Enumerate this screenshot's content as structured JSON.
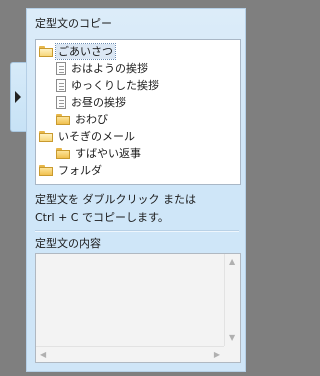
{
  "panel": {
    "copy_section_title": "定型文のコピー",
    "content_section_title": "定型文の内容",
    "help_line1": "定型文を ダブルクリック または",
    "help_line2": "Ctrl + C でコピーします。",
    "content_text": ""
  },
  "tree": [
    {
      "label": "ごあいさつ",
      "type": "folder-open",
      "selected": true
    },
    {
      "label": "おはようの挨拶",
      "type": "document"
    },
    {
      "label": "ゆっくりした挨拶",
      "type": "document"
    },
    {
      "label": "お昼の挨拶",
      "type": "document"
    },
    {
      "label": "おわび",
      "type": "folder"
    },
    {
      "label": "いそぎのメール",
      "type": "folder-open"
    },
    {
      "label": "すばやい返事",
      "type": "folder"
    },
    {
      "label": "フォルダ",
      "type": "folder"
    }
  ],
  "icons": {
    "collapse": "chevron-right-icon",
    "scroll_up": "scroll-up-arrow-icon",
    "scroll_down": "scroll-down-arrow-icon",
    "scroll_left": "scroll-left-arrow-icon",
    "scroll_right": "scroll-right-arrow-icon"
  },
  "colors": {
    "panel_bg": "#cfe5f7",
    "outer_bg": "#7f7f7f",
    "folder": "#f0c04f"
  }
}
